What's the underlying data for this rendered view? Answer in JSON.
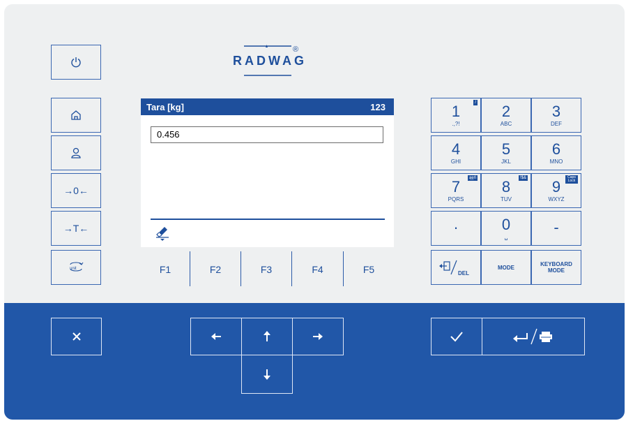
{
  "brand": {
    "logo_text": "RADWAG",
    "registered": "®"
  },
  "left_column": {
    "power": "power-icon",
    "home": "home-icon",
    "user": "user-icon",
    "zero_label": "→0←",
    "tare_label": "→T←",
    "unit": "unit-icon",
    "unit_sublabel": "unit"
  },
  "screen": {
    "title": "Tara [kg]",
    "input_mode": "123",
    "input_value": "0.456",
    "footer_icon": "eraser-icon"
  },
  "function_keys": [
    "F1",
    "F2",
    "F3",
    "F4",
    "F5"
  ],
  "keypad": {
    "keys": [
      {
        "main": "1",
        "sub": ".,?!",
        "badge": "/"
      },
      {
        "main": "2",
        "sub": "ABC"
      },
      {
        "main": "3",
        "sub": "DEF"
      },
      {
        "main": "4",
        "sub": "GHI"
      },
      {
        "main": "5",
        "sub": "JKL"
      },
      {
        "main": "6",
        "sub": "MNO"
      },
      {
        "main": "7",
        "sub": "PQRS",
        "badge": "ąęń"
      },
      {
        "main": "8",
        "sub": "TUV",
        "badge": "!$&"
      },
      {
        "main": "9",
        "sub": "WXYZ",
        "badge": "Caps Lock"
      },
      {
        "main": "·"
      },
      {
        "main": "0",
        "sub": "␣"
      },
      {
        "main": "-"
      }
    ],
    "del_label": "DEL",
    "mode_label": "MODE",
    "keyboard_mode_label": "KEYBOARD MODE"
  },
  "bottom": {
    "cancel": "close-icon",
    "left": "arrow-left-icon",
    "up": "arrow-up-icon",
    "right": "arrow-right-icon",
    "down": "arrow-down-icon",
    "confirm": "check-icon",
    "enter_print": "enter-print-icon"
  },
  "colors": {
    "brand_blue": "#1e4f9c",
    "panel_bg": "#eef0f1",
    "bottom_bg": "#2157a8"
  }
}
